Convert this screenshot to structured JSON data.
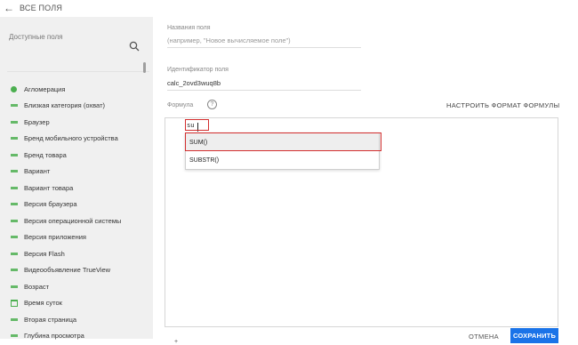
{
  "header": {
    "back_label": "ВСЕ ПОЛЯ"
  },
  "sidebar": {
    "search_placeholder": "Доступные поля",
    "fields": [
      {
        "label": "Агломерация",
        "icon": "globe-icon"
      },
      {
        "label": "Близкая категория (охват)",
        "icon": "dimension-icon"
      },
      {
        "label": "Браузер",
        "icon": "dimension-icon"
      },
      {
        "label": "Бренд мобильного устройства",
        "icon": "dimension-icon"
      },
      {
        "label": "Бренд товара",
        "icon": "dimension-icon"
      },
      {
        "label": "Вариант",
        "icon": "dimension-icon"
      },
      {
        "label": "Вариант товара",
        "icon": "dimension-icon"
      },
      {
        "label": "Версия браузера",
        "icon": "dimension-icon"
      },
      {
        "label": "Версия операционной системы",
        "icon": "dimension-icon"
      },
      {
        "label": "Версия приложения",
        "icon": "dimension-icon"
      },
      {
        "label": "Версия Flash",
        "icon": "dimension-icon"
      },
      {
        "label": "Видеообъявление TrueView",
        "icon": "dimension-icon"
      },
      {
        "label": "Возраст",
        "icon": "dimension-icon"
      },
      {
        "label": "Время суток",
        "icon": "calendar-icon"
      },
      {
        "label": "Вторая страница",
        "icon": "dimension-icon"
      },
      {
        "label": "Глубина просмотра",
        "icon": "dimension-icon"
      }
    ]
  },
  "form": {
    "name_label": "Названия поля",
    "name_placeholder": "(например, \"Новое вычисляемое поле\")",
    "id_label": "Идентификатор поля",
    "id_value": "calc_2ovd3wuq8b",
    "formula_label": "Формула",
    "format_button": "НАСТРОИТЬ ФОРМАТ ФОРМУЛЫ",
    "formula_value": "su",
    "autocomplete": [
      "SUM()",
      "SUBSTR()"
    ]
  },
  "footer": {
    "cancel_label": "ОТМЕНА",
    "save_label": "СОХРАНИТЬ",
    "small_mark": "+"
  },
  "colors": {
    "accent": "#1a73e8",
    "highlight": "#d32f2f",
    "dimension": "#4caf50"
  }
}
